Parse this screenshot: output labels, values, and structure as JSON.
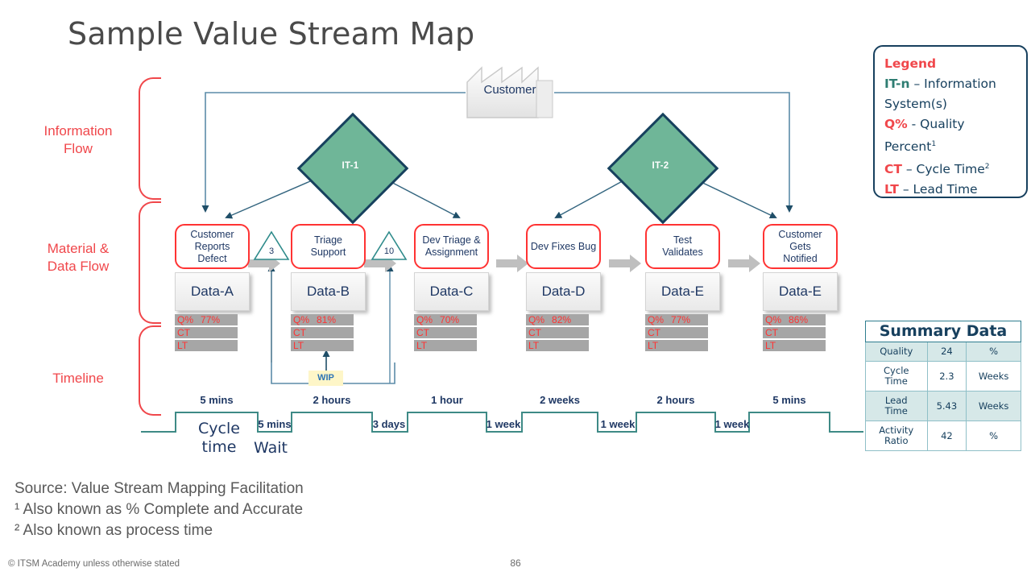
{
  "title": "Sample Value Stream Map",
  "lanes": [
    {
      "label": "Information\nFlow",
      "line1": "Information",
      "line2": "Flow"
    },
    {
      "label": "Material &\nData Flow",
      "line1": "Material &",
      "line2": "Data Flow"
    },
    {
      "label": "Timeline",
      "line1": "Timeline",
      "line2": ""
    }
  ],
  "customer": {
    "label": "Customer",
    "icon": "factory-icon"
  },
  "systems": [
    {
      "id": "IT-1",
      "label": "IT-1"
    },
    {
      "id": "IT-2",
      "label": "IT-2"
    }
  ],
  "processes": [
    {
      "name_lines": [
        "Customer",
        "Reports",
        "Defect"
      ],
      "data_label": "Data-A",
      "metrics": {
        "quality_label": "Q%",
        "quality_value": "77%",
        "ct_label": "CT",
        "ct_value": "",
        "lt_label": "LT",
        "lt_value": ""
      }
    },
    {
      "name_lines": [
        "Triage",
        "Support"
      ],
      "data_label": "Data-B",
      "metrics": {
        "quality_label": "Q%",
        "quality_value": "81%",
        "ct_label": "CT",
        "ct_value": "",
        "lt_label": "LT",
        "lt_value": ""
      }
    },
    {
      "name_lines": [
        "Dev Triage  &",
        "Assignment"
      ],
      "data_label": "Data-C",
      "metrics": {
        "quality_label": "Q%",
        "quality_value": "70%",
        "ct_label": "CT",
        "ct_value": "",
        "lt_label": "LT",
        "lt_value": ""
      }
    },
    {
      "name_lines": [
        "Dev Fixes Bug"
      ],
      "data_label": "Data-D",
      "metrics": {
        "quality_label": "Q%",
        "quality_value": "82%",
        "ct_label": "CT",
        "ct_value": "",
        "lt_label": "LT",
        "lt_value": ""
      }
    },
    {
      "name_lines": [
        "Test",
        "Validates"
      ],
      "data_label": "Data-E",
      "metrics": {
        "quality_label": "Q%",
        "quality_value": "77%",
        "ct_label": "CT",
        "ct_value": "",
        "lt_label": "LT",
        "lt_value": ""
      }
    },
    {
      "name_lines": [
        "Customer",
        "Gets",
        "Notified"
      ],
      "data_label": "Data-E",
      "metrics": {
        "quality_label": "Q%",
        "quality_value": "86%",
        "ct_label": "CT",
        "ct_value": "",
        "lt_label": "LT",
        "lt_value": ""
      }
    }
  ],
  "inventory": [
    {
      "count": "3"
    },
    {
      "count": "10"
    }
  ],
  "wip": {
    "label": "WIP"
  },
  "timeline": {
    "process_times": [
      "5 mins",
      "2 hours",
      "1 hour",
      "2 weeks",
      "2 hours",
      "5 mins"
    ],
    "wait_times": [
      "5 mins",
      "3 days",
      "1 week",
      "1 week",
      "1 week"
    ],
    "cycle_time_caption_line1": "Cycle",
    "cycle_time_caption_line2": "time",
    "wait_caption": "Wait"
  },
  "legend": {
    "title": "Legend",
    "entries": [
      {
        "key": "IT-n",
        "key_color": "teal",
        "text": " – Information System(s)"
      },
      {
        "key": "Q%",
        "key_color": "red",
        "text": " - Quality Percent",
        "sup": "1"
      },
      {
        "key": "CT",
        "key_color": "red",
        "text": " – Cycle Time",
        "sup": "2"
      },
      {
        "key": "LT",
        "key_color": "red",
        "text": " – Lead Time"
      }
    ]
  },
  "summary": {
    "title": "Summary Data",
    "rows": [
      {
        "metric": "Quality",
        "value": "24",
        "unit": "%"
      },
      {
        "metric": "Cycle Time",
        "metric_l1": "Cycle",
        "metric_l2": "Time",
        "value": "2.3",
        "unit": "Weeks"
      },
      {
        "metric": "Lead Time",
        "metric_l1": "Lead",
        "metric_l2": "Time",
        "value": "5.43",
        "unit": "Weeks"
      },
      {
        "metric": "Activity Ratio",
        "metric_l1": "Activity",
        "metric_l2": "Ratio",
        "value": "42",
        "unit": "%"
      }
    ]
  },
  "footer": {
    "source": "Source: Value Stream Mapping Facilitation",
    "note1": "¹ Also known as % Complete and Accurate",
    "note2": "² Also known as process time",
    "copyright": "©  ITSM Academy unless otherwise stated",
    "page_number": "86"
  },
  "colors": {
    "red_accent": "#F0474B",
    "process_border": "#FF3333",
    "navy": "#17405E",
    "green": "#6FB698",
    "teal": "#2E7D72",
    "metric_bar": "#A6A6A6",
    "wip_bg": "#FEF6C8"
  }
}
